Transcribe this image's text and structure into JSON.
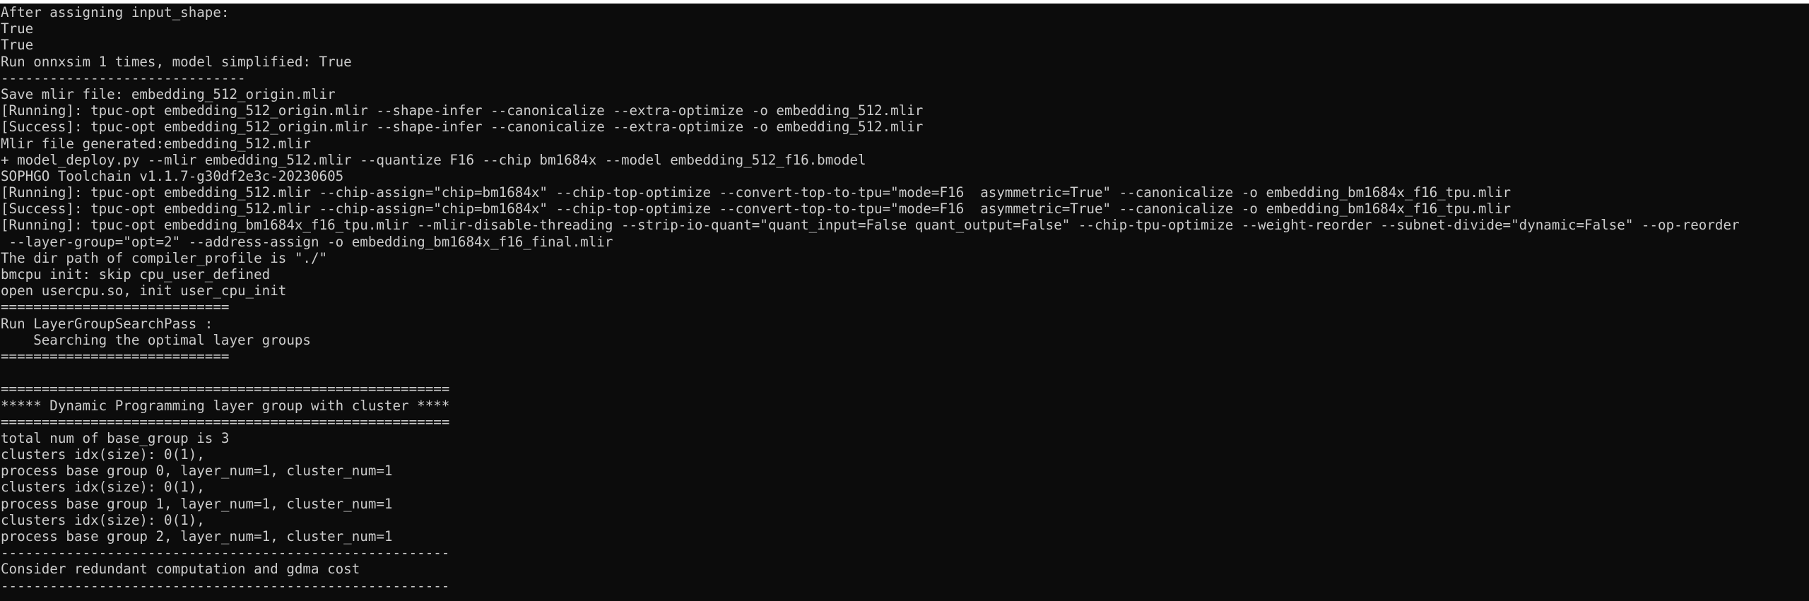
{
  "terminal": {
    "background": "#0c0c0c",
    "foreground": "#cccccc",
    "lines": [
      "After assigning input_shape:",
      "True",
      "True",
      "Run onnxsim 1 times, model simplified: True",
      "------------------------------",
      "Save mlir file: embedding_512_origin.mlir",
      "[Running]: tpuc-opt embedding_512_origin.mlir --shape-infer --canonicalize --extra-optimize -o embedding_512.mlir",
      "[Success]: tpuc-opt embedding_512_origin.mlir --shape-infer --canonicalize --extra-optimize -o embedding_512.mlir",
      "Mlir file generated:embedding_512.mlir",
      "+ model_deploy.py --mlir embedding_512.mlir --quantize F16 --chip bm1684x --model embedding_512_f16.bmodel",
      "SOPHGO Toolchain v1.1.7-g30df2e3c-20230605",
      "[Running]: tpuc-opt embedding_512.mlir --chip-assign=\"chip=bm1684x\" --chip-top-optimize --convert-top-to-tpu=\"mode=F16  asymmetric=True\" --canonicalize -o embedding_bm1684x_f16_tpu.mlir",
      "[Success]: tpuc-opt embedding_512.mlir --chip-assign=\"chip=bm1684x\" --chip-top-optimize --convert-top-to-tpu=\"mode=F16  asymmetric=True\" --canonicalize -o embedding_bm1684x_f16_tpu.mlir",
      "[Running]: tpuc-opt embedding_bm1684x_f16_tpu.mlir --mlir-disable-threading --strip-io-quant=\"quant_input=False quant_output=False\" --chip-tpu-optimize --weight-reorder --subnet-divide=\"dynamic=False\" --op-reorder",
      " --layer-group=\"opt=2\" --address-assign -o embedding_bm1684x_f16_final.mlir",
      "The dir path of compiler_profile is \"./\"",
      "bmcpu init: skip cpu_user_defined",
      "open usercpu.so, init user_cpu_init",
      "============================",
      "Run LayerGroupSearchPass :",
      "    Searching the optimal layer groups",
      "============================",
      "",
      "=======================================================",
      "***** Dynamic Programming layer group with cluster ****",
      "=======================================================",
      "total num of base_group is 3",
      "clusters idx(size): 0(1),",
      "process base group 0, layer_num=1, cluster_num=1",
      "clusters idx(size): 0(1),",
      "process base group 1, layer_num=1, cluster_num=1",
      "clusters idx(size): 0(1),",
      "process base group 2, layer_num=1, cluster_num=1",
      "-------------------------------------------------------",
      "Consider redundant computation and gdma cost",
      "-------------------------------------------------------",
      "-------------------------------------------------------"
    ]
  }
}
